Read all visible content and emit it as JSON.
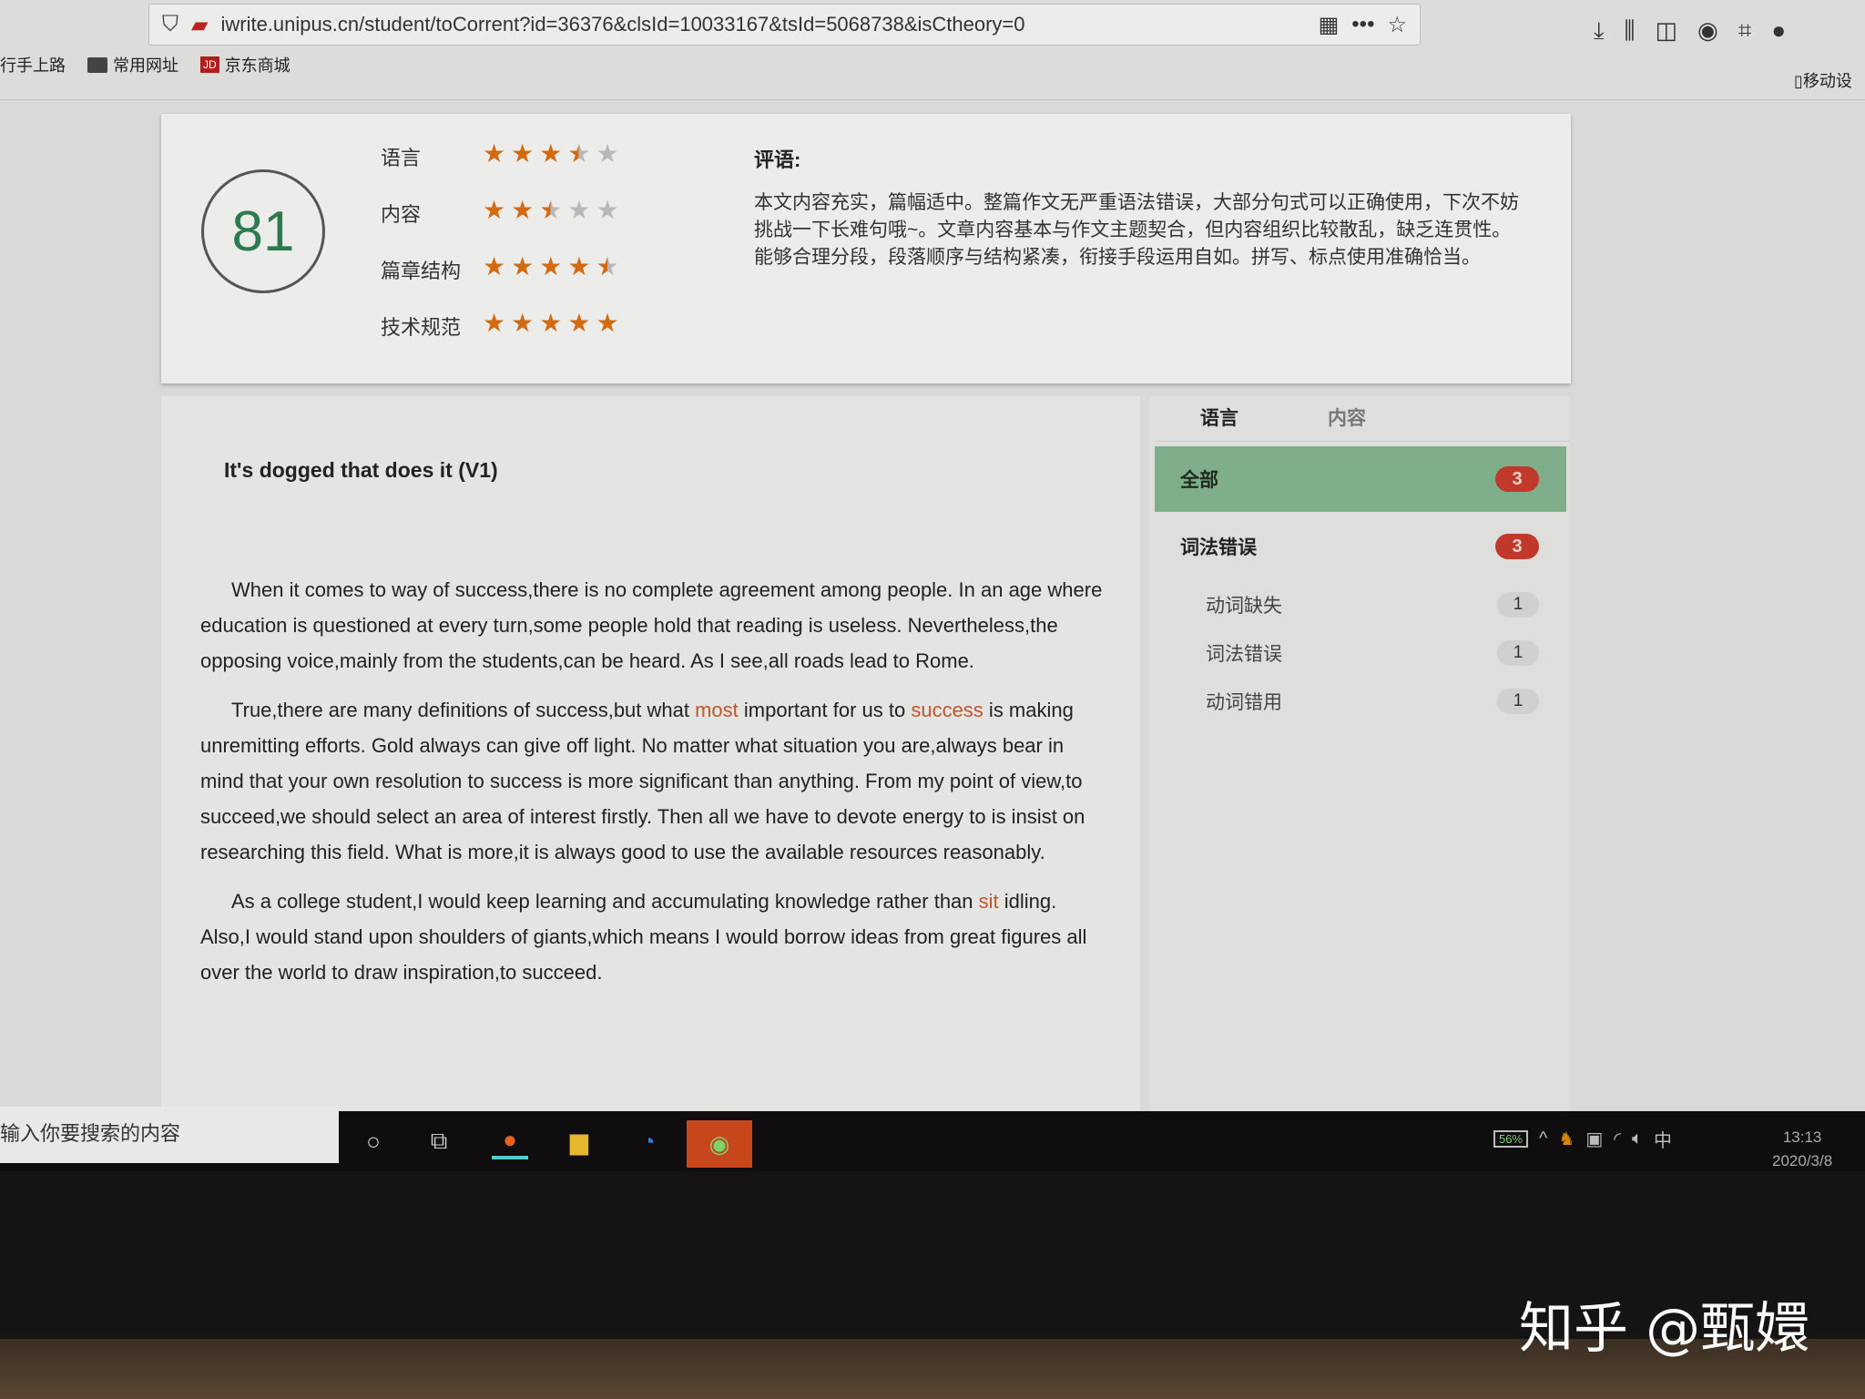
{
  "browser": {
    "url": "iwrite.unipus.cn/student/toCorrent?id=36376&clsId=10033167&tsId=5068738&isCtheory=0",
    "bookmarks": [
      "行手上路",
      "常用网址",
      "京东商城"
    ],
    "jd_logo": "JD",
    "mobile_label": "移动设"
  },
  "score": {
    "value": "81",
    "ratings": [
      {
        "label": "语言",
        "stars": 3.5
      },
      {
        "label": "内容",
        "stars": 2.5
      },
      {
        "label": "篇章结构",
        "stars": 4.5
      },
      {
        "label": "技术规范",
        "stars": 5
      }
    ],
    "comment_title": "评语:",
    "comment": "本文内容充实，篇幅适中。整篇作文无严重语法错误，大部分句式可以正确使用，下次不妨挑战一下长难句哦~。文章内容基本与作文主题契合，但内容组织比较散乱，缺乏连贯性。能够合理分段，段落顺序与结构紧凑，衔接手段运用自如。拼写、标点使用准确恰当。"
  },
  "essay": {
    "title": "It's dogged that does it   (V1)",
    "p1": "When it comes to way of success,there is no complete agreement among people.   In an age where education is questioned at every turn,some people hold that reading is useless.   Nevertheless,the opposing voice,mainly from the students,can be heard.   As I see,all roads lead to Rome.",
    "p2a": "True,there are many definitions of success,but what ",
    "p2err1": "most",
    "p2b": " important for us to ",
    "p2err2": "success",
    "p2c": " is making unremitting efforts.   Gold always can give off light.   No matter what situation you are,always bear in mind that your own resolution to success is more significant than anything.   From my point of view,to succeed,we should select an area of interest firstly.   Then all we have to devote energy to is insist on researching this field.   What is more,it is always good to use the available resources reasonably.",
    "p3a": "As a college student,I would keep learning and accumulating knowledge rather than ",
    "p3err": "sit",
    "p3b": " idling.   Also,I would stand upon shoulders of giants,which means I would borrow ideas from great figures all over the world to draw inspiration,to succeed."
  },
  "side": {
    "tabs": [
      "语言",
      "内容"
    ],
    "active_tab": "语言",
    "all": {
      "label": "全部",
      "count": "3"
    },
    "category": {
      "label": "词法错误",
      "count": "3"
    },
    "items": [
      {
        "label": "动词缺失",
        "count": "1"
      },
      {
        "label": "词法错误",
        "count": "1"
      },
      {
        "label": "动词错用",
        "count": "1"
      }
    ]
  },
  "taskbar": {
    "search_placeholder": "输入你要搜索的内容",
    "battery": "56%",
    "ime": "中",
    "time": "13:13",
    "date": "2020/3/8"
  },
  "watermark": "知乎 @甄嬛",
  "colors": {
    "score": "#2d7a50",
    "star": "#d46a10",
    "active_row": "#7fae8a",
    "badge": "#c0392b",
    "error_text": "#c0572a"
  }
}
